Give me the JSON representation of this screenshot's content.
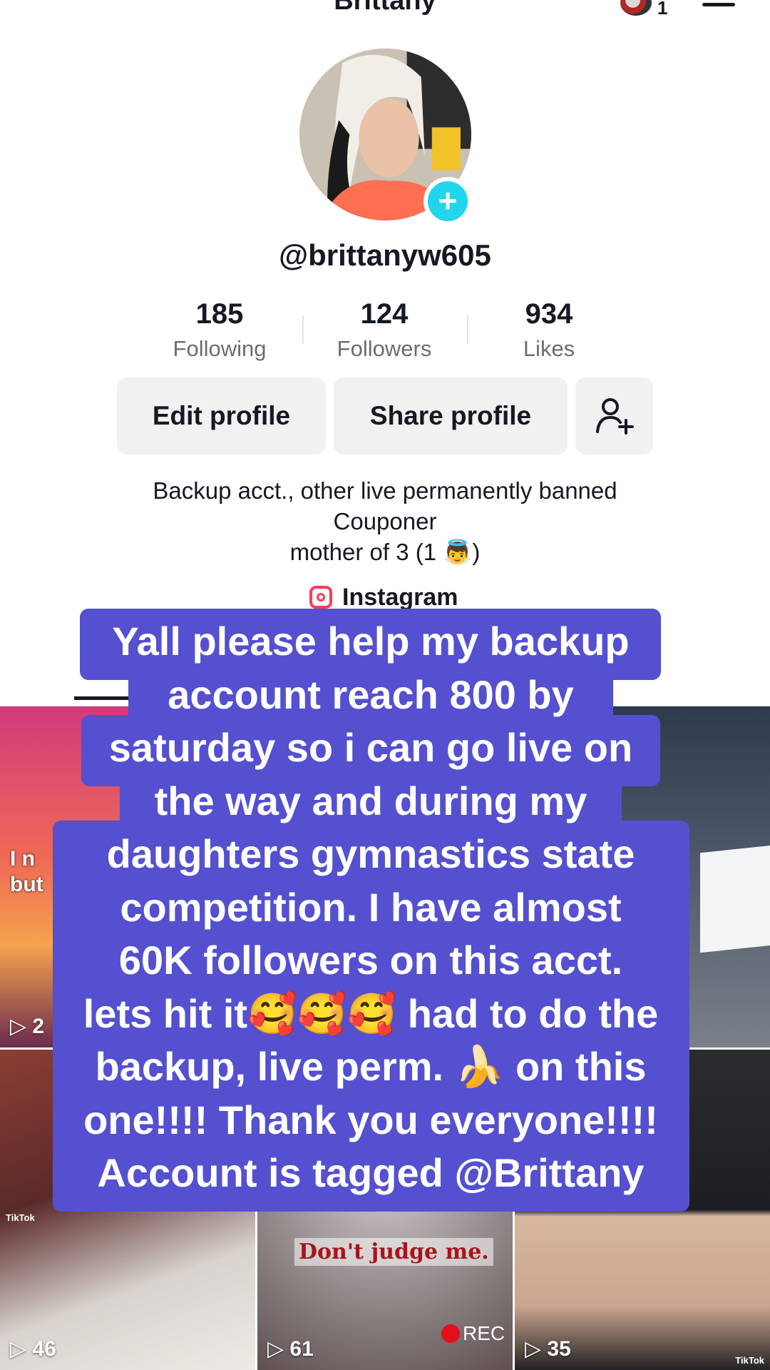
{
  "header": {
    "title": "Brittany",
    "notification_count": "1"
  },
  "profile": {
    "username": "@brittanyw605",
    "stats": [
      {
        "value": "185",
        "label": "Following"
      },
      {
        "value": "124",
        "label": "Followers"
      },
      {
        "value": "934",
        "label": "Likes"
      }
    ],
    "buttons": {
      "edit": "Edit profile",
      "share": "Share profile"
    },
    "bio": [
      "Backup acct., other live permanently banned",
      "Couponer",
      "mother of 3 (1 👼)"
    ],
    "link": "Instagram"
  },
  "grid": {
    "tiles": [
      {
        "views": "2",
        "caption": "I m\nbut"
      },
      {
        "views": ""
      },
      {
        "views": ""
      },
      {
        "views": "46",
        "watermark": "TikTok"
      },
      {
        "views": "61",
        "caption": "Don't judge me.",
        "rec": "REC"
      },
      {
        "views": "35",
        "watermark": "TikTok"
      }
    ]
  },
  "overlay": {
    "lines": [
      "Yall please help my backup",
      "account reach 800 by",
      "saturday so i can go live on",
      "the way and during my",
      "daughters gymnastics state",
      "competition. I have almost",
      "60K followers on this acct.",
      "lets hit it🥰🥰🥰 had to do the",
      "backup, live perm. 🍌 on this",
      "one!!!! Thank you everyone!!!!",
      "Account is tagged @Brittany"
    ],
    "color": "#5450d0"
  }
}
